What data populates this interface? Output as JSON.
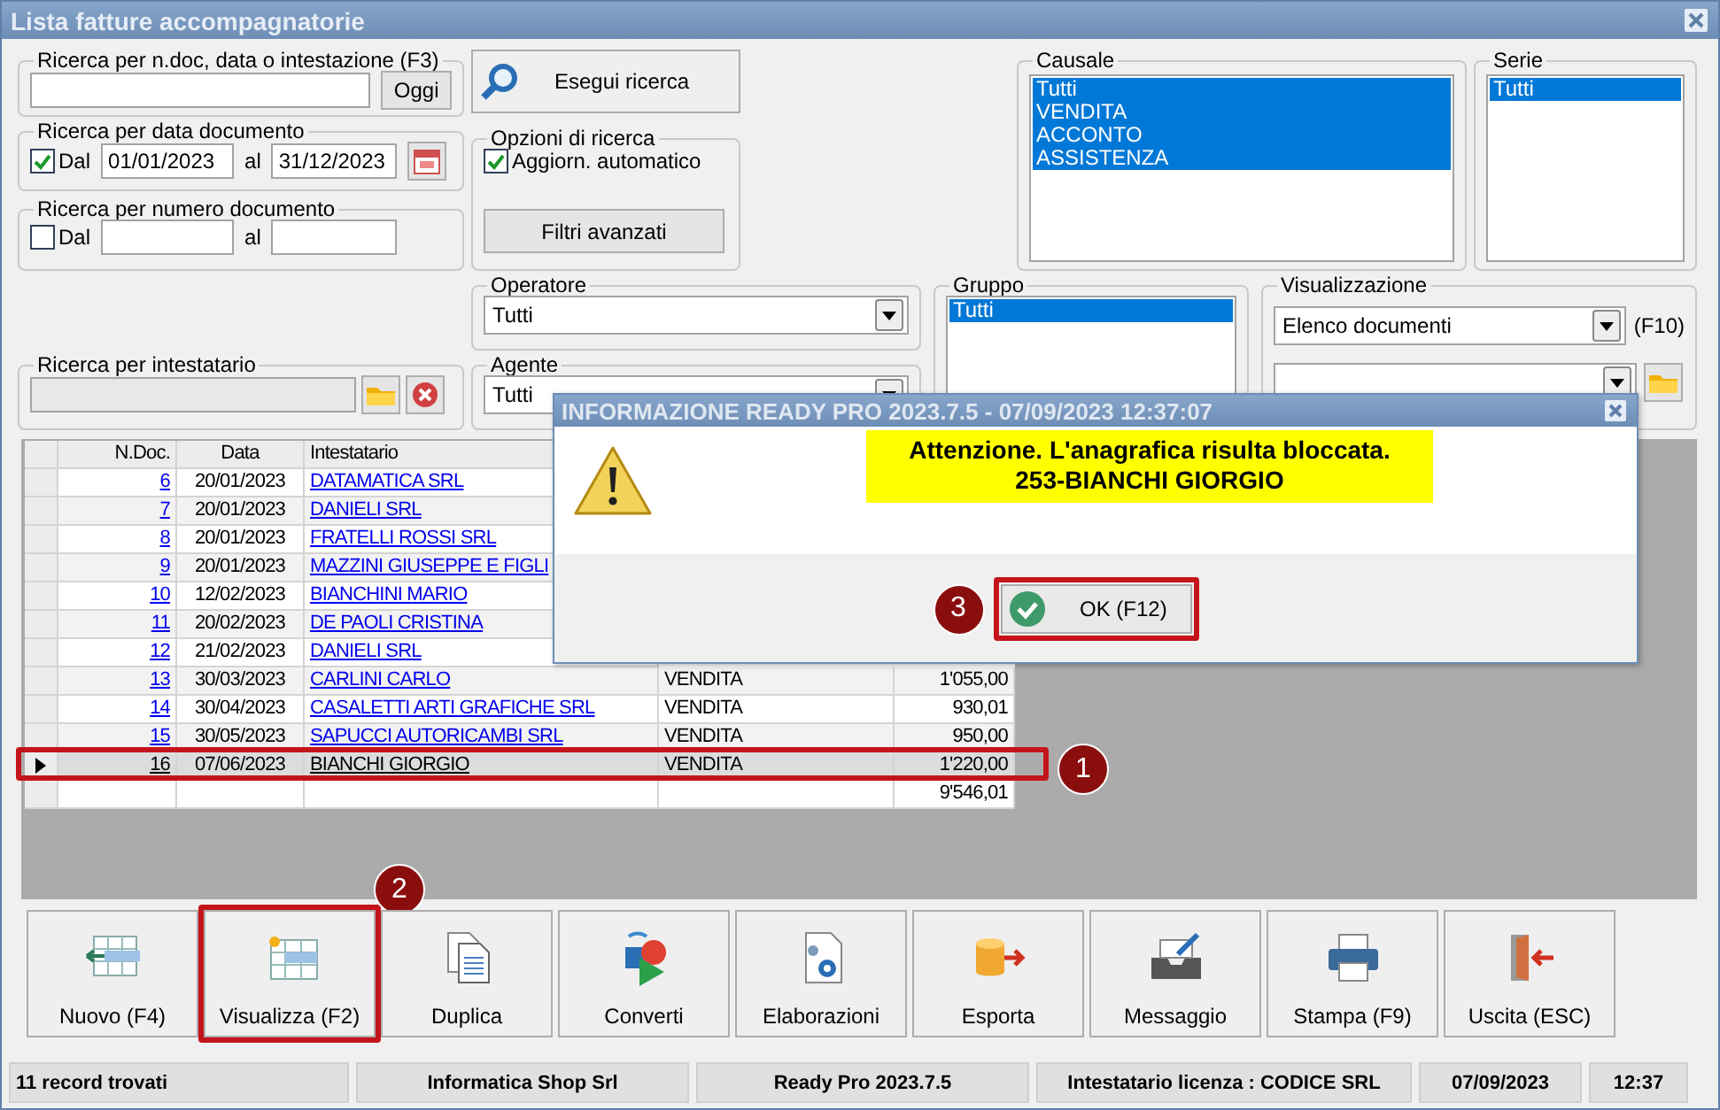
{
  "window": {
    "title": "Lista fatture accompagnatorie"
  },
  "text_search": {
    "legend": "Ricerca per n.doc, data o intestazione (F3)",
    "today_button": "Oggi"
  },
  "run_search_button": "Esegui ricerca",
  "date_search": {
    "legend": "Ricerca per data documento",
    "checked": true,
    "from_label": "Dal",
    "from": "01/01/2023",
    "to_label": "al",
    "to": "31/12/2023"
  },
  "number_search": {
    "legend": "Ricerca per numero documento",
    "checked": false,
    "from_label": "Dal",
    "to_label": "al"
  },
  "options": {
    "legend": "Opzioni di ricerca",
    "auto_update_label": "Aggiorn. automatico",
    "auto_update_checked": true,
    "advanced_button": "Filtri avanzati"
  },
  "holder_search": {
    "legend": "Ricerca per intestatario"
  },
  "operatore": {
    "legend": "Operatore",
    "value": "Tutti"
  },
  "agente": {
    "legend": "Agente",
    "value": "Tutti"
  },
  "causale": {
    "legend": "Causale",
    "items": [
      {
        "label": "Tutti",
        "selected": true
      },
      {
        "label": "VENDITA",
        "selected": true
      },
      {
        "label": "ACCONTO",
        "selected": true
      },
      {
        "label": "ASSISTENZA",
        "selected": true
      }
    ]
  },
  "serie": {
    "legend": "Serie",
    "items": [
      {
        "label": "Tutti",
        "selected": true
      }
    ]
  },
  "gruppo": {
    "legend": "Gruppo",
    "items": [
      {
        "label": "Tutti",
        "selected": true
      }
    ]
  },
  "visualizzazione": {
    "legend": "Visualizzazione",
    "value": "Elenco documenti",
    "shortcut": "(F10)"
  },
  "table": {
    "columns": [
      "N.Doc.",
      "Data",
      "Intestatario"
    ],
    "rows": [
      {
        "n_doc": "6",
        "data": "20/01/2023",
        "intestatario": "DATAMATICA SRL",
        "selected": false
      },
      {
        "n_doc": "7",
        "data": "20/01/2023",
        "intestatario": "DANIELI SRL",
        "selected": false
      },
      {
        "n_doc": "8",
        "data": "20/01/2023",
        "intestatario": "FRATELLI ROSSI SRL",
        "selected": false
      },
      {
        "n_doc": "9",
        "data": "20/01/2023",
        "intestatario": "MAZZINI GIUSEPPE E FIGLI",
        "selected": false
      },
      {
        "n_doc": "10",
        "data": "12/02/2023",
        "intestatario": "BIANCHINI MARIO",
        "selected": false
      },
      {
        "n_doc": "11",
        "data": "20/02/2023",
        "intestatario": "DE PAOLI CRISTINA",
        "selected": false
      },
      {
        "n_doc": "12",
        "data": "21/02/2023",
        "intestatario": "DANIELI SRL",
        "selected": false
      },
      {
        "n_doc": "13",
        "data": "30/03/2023",
        "intestatario": "CARLINI CARLO",
        "causale": "VENDITA",
        "importo": "1'055,00",
        "selected": false
      },
      {
        "n_doc": "14",
        "data": "30/04/2023",
        "intestatario": "CASALETTI ARTI GRAFICHE SRL",
        "causale": "VENDITA",
        "importo": "930,01",
        "selected": false
      },
      {
        "n_doc": "15",
        "data": "30/05/2023",
        "intestatario": "SAPUCCI AUTORICAMBI SRL",
        "causale": "VENDITA",
        "importo": "950,00",
        "selected": false
      },
      {
        "n_doc": "16",
        "data": "07/06/2023",
        "intestatario": "BIANCHI GIORGIO",
        "causale": "VENDITA",
        "importo": "1'220,00",
        "selected": true,
        "callout": "1"
      }
    ],
    "total": "9'546,01"
  },
  "toolbar": [
    {
      "label": "Nuovo (F4)",
      "kind": "new"
    },
    {
      "label": "Visualizza (F2)",
      "kind": "view",
      "callout": "2"
    },
    {
      "label": "Duplica",
      "kind": "duplicate"
    },
    {
      "label": "Converti",
      "kind": "convert"
    },
    {
      "label": "Elaborazioni",
      "kind": "process"
    },
    {
      "label": "Esporta",
      "kind": "export"
    },
    {
      "label": "Messaggio",
      "kind": "message"
    },
    {
      "label": "Stampa (F9)",
      "kind": "print"
    },
    {
      "label": "Uscita (ESC)",
      "kind": "exit"
    }
  ],
  "status_bar": [
    "11 record trovati",
    "Informatica Shop Srl",
    "Ready Pro 2023.7.5",
    "Intestatario licenza : CODICE SRL",
    "07/09/2023",
    "12:37"
  ],
  "dialog": {
    "title": "INFORMAZIONE READY PRO 2023.7.5 - 07/09/2023 12:37:07",
    "message": "Attenzione. L'anagrafica risulta bloccata.",
    "detail": "253-BIANCHI GIORGIO",
    "ok_button": "OK (F12)",
    "callout": "3"
  }
}
